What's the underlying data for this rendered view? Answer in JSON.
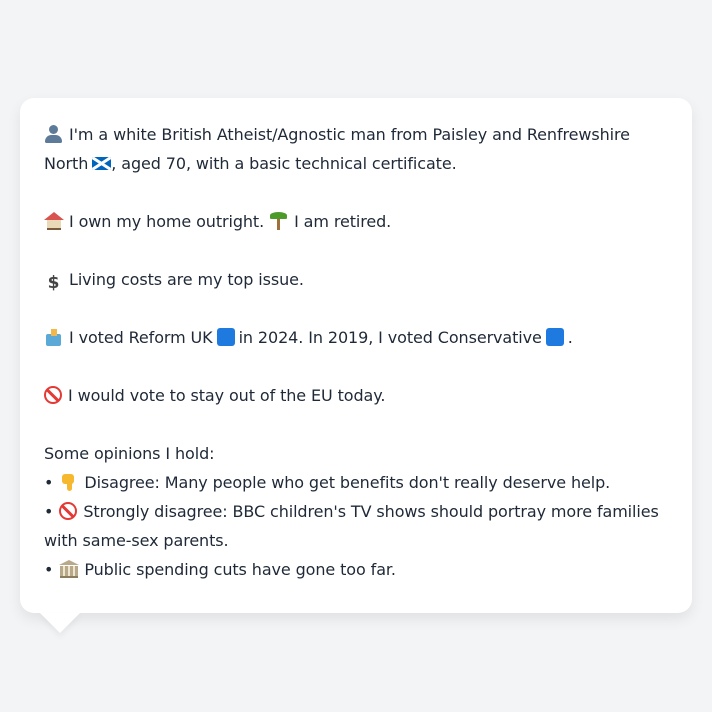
{
  "profile": {
    "intro": {
      "icon": "person-icon",
      "text": "I'm a white British Atheist/Agnostic man from Paisley and Renfrewshire North",
      "flag_icon": "scotland-flag-icon",
      "text_after": ", aged 70, with a basic technical certificate."
    },
    "home": {
      "icon": "house-icon",
      "text": "I own my home outright.",
      "icon2": "palm-tree-icon",
      "text2": "I am retired."
    },
    "issue": {
      "icon": "dollar-icon",
      "symbol": "$",
      "text": "Living costs are my top issue."
    },
    "vote": {
      "icon": "ballot-box-icon",
      "text1": "I voted Reform UK",
      "text2": "in 2024. In 2019, I voted Conservative",
      "text3": ".",
      "party_color": "#1f7ae0"
    },
    "eu": {
      "icon": "no-entry-icon",
      "text": "I would vote to stay out of the EU today."
    },
    "opinions_heading": "Some opinions I hold:",
    "opinions": [
      {
        "bullet": "•",
        "icon": "thumbs-down-icon",
        "text": "Disagree: Many people who get benefits don't really deserve help."
      },
      {
        "bullet": "•",
        "icon": "no-entry-icon",
        "text": "Strongly disagree: BBC children's TV shows should portray more families with same-sex parents."
      },
      {
        "bullet": "•",
        "icon": "classical-building-icon",
        "text": "Public spending cuts have gone too far."
      }
    ]
  }
}
